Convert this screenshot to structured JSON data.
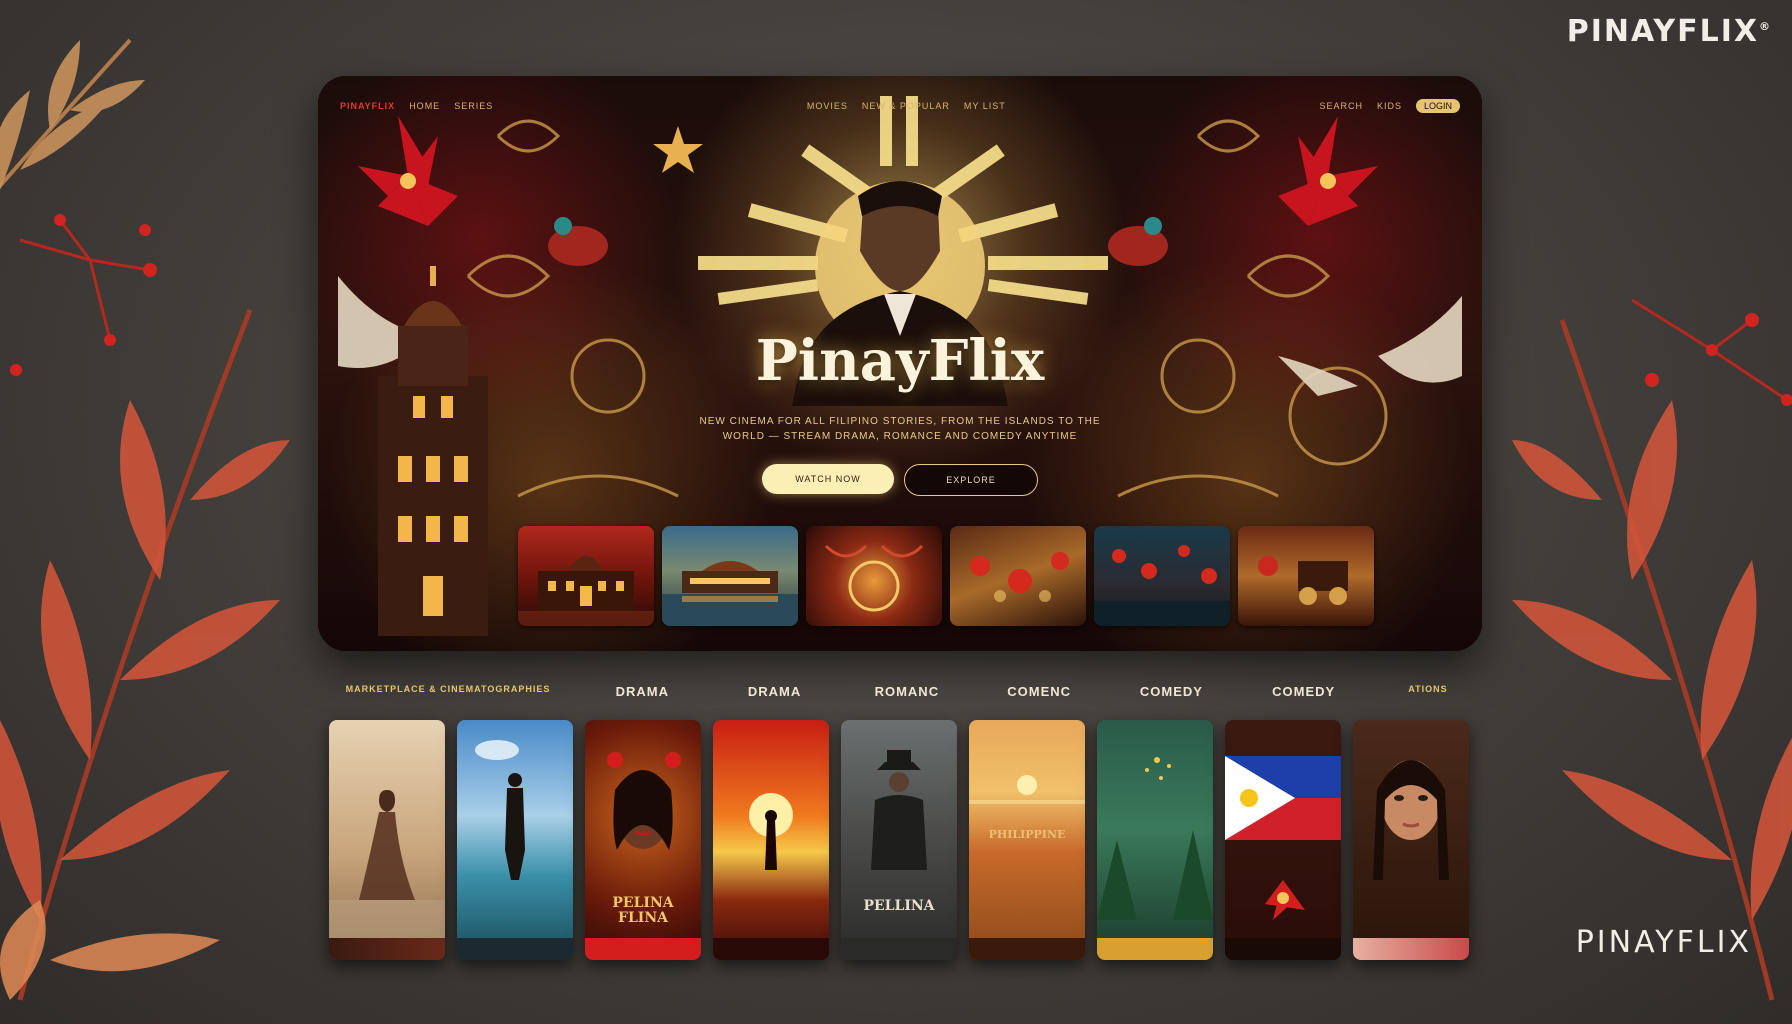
{
  "brand": {
    "corner": "PINAYFLIX",
    "corner_mark": "®",
    "bottom": "PINAYFLIX"
  },
  "hero": {
    "title": "PinayFlix",
    "subtitle_line1": "NEW CINEMA FOR ALL FILIPINO STORIES, FROM THE ISLANDS TO THE",
    "subtitle_line2": "WORLD — STREAM DRAMA, ROMANCE AND COMEDY ANYTIME",
    "primary_button": "WATCH NOW",
    "secondary_button": "EXPLORE"
  },
  "nav": {
    "left": [
      "PINAYFLIX",
      "HOME",
      "SERIES"
    ],
    "center": [
      "MOVIES",
      "NEW & POPULAR",
      "MY LIST"
    ],
    "right_items": [
      "SEARCH",
      "KIDS"
    ],
    "right_pill": "LOGIN"
  },
  "categories": [
    {
      "label": "MARKETPLACE & CINEMATOGRAPHIES",
      "small": true
    },
    {
      "label": "DRAMA"
    },
    {
      "label": "DRAMA"
    },
    {
      "label": "ROMANC"
    },
    {
      "label": "COMENC"
    },
    {
      "label": "COMEDY"
    },
    {
      "label": "COMEDY"
    },
    {
      "label": "ATIONS",
      "small": true
    }
  ],
  "posters": [
    {
      "name": "woman-shore",
      "caption": ""
    },
    {
      "name": "man-in-water",
      "caption": ""
    },
    {
      "name": "woman-portrait",
      "caption": "PELINA FLINA"
    },
    {
      "name": "sunset-silhouette",
      "caption": ""
    },
    {
      "name": "cowboy",
      "caption": "PELLINA"
    },
    {
      "name": "sunset-sea",
      "caption": "PHILIPPINE"
    },
    {
      "name": "forest-spark",
      "caption": ""
    },
    {
      "name": "flag-flower",
      "caption": ""
    },
    {
      "name": "woman-face",
      "caption": ""
    }
  ],
  "colors": {
    "gold": "#e7c56e",
    "cream": "#fbefb6",
    "red": "#c8141e",
    "flag_blue": "#1f3fa8",
    "flag_red": "#d0202a",
    "flag_yellow": "#f5c518"
  }
}
